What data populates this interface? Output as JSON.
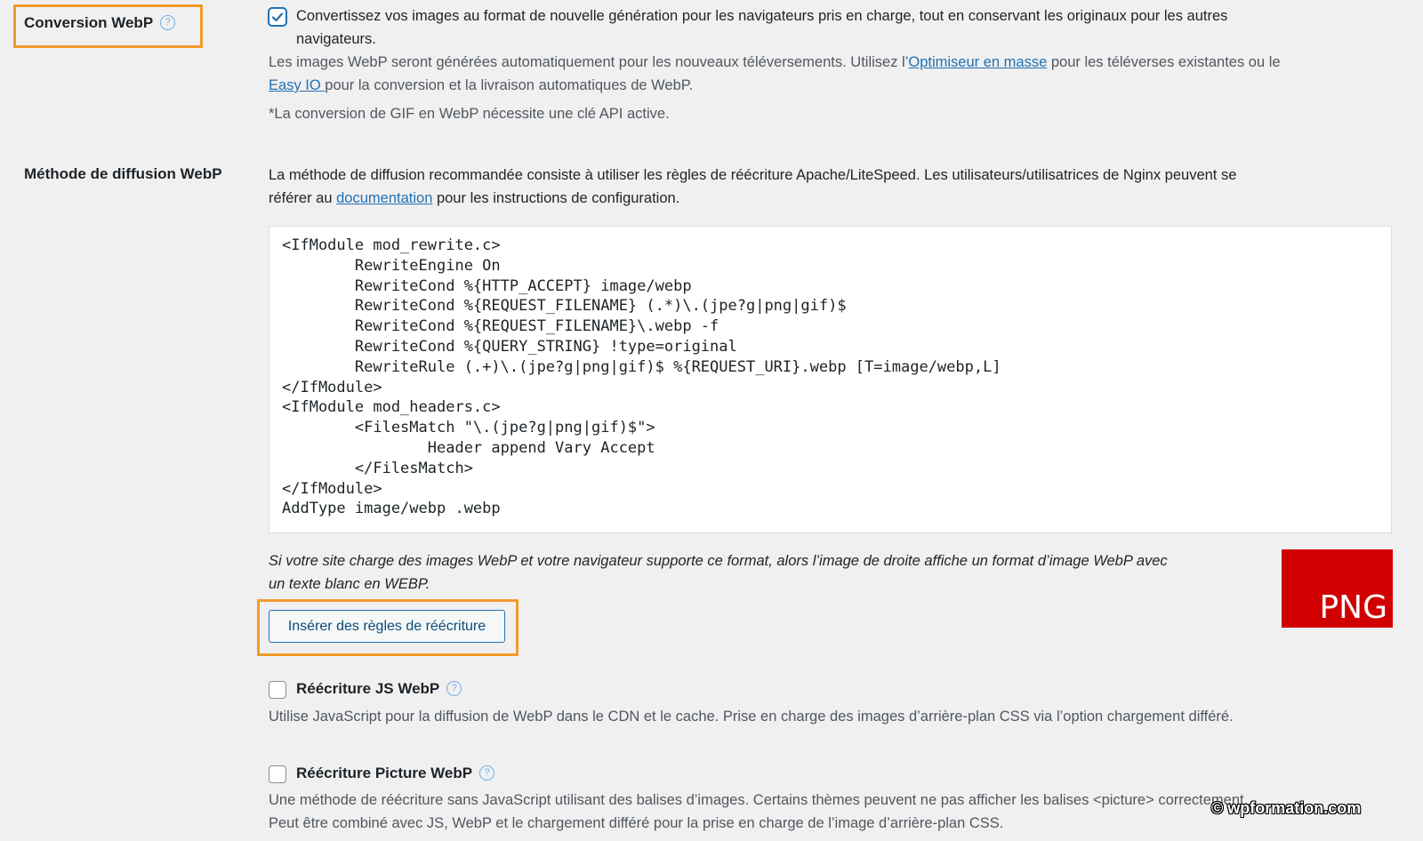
{
  "webp_conversion": {
    "label": "Conversion WebP",
    "help_symbol": "?",
    "checked": true,
    "checkbox_text_line1": "Convertissez vos images au format de nouvelle génération pour les navigateurs pris en charge, tout en conservant les originaux pour les autres",
    "checkbox_text_line2": "navigateurs.",
    "desc_line1_before": "Les images WebP seront générées automatiquement pour les nouveaux téléversements. Utilisez l’",
    "bulk_optimizer_link": "Optimiseur en masse",
    "desc_line1_after": " pour les téléverses existantes ou le",
    "easy_io_link": "Easy IO ",
    "desc_line2_after": "pour la conversion et la livraison automatiques de WebP.",
    "gif_note": "*La conversion de GIF en WebP nécessite une clé API active."
  },
  "webp_delivery": {
    "label": "Méthode de diffusion WebP",
    "intro_line1": "La méthode de diffusion recommandée consiste à utiliser les règles de réécriture Apache/LiteSpeed. Les utilisateurs/utilisatrices de Nginx peuvent se",
    "intro_line2_before": "référer au ",
    "documentation_link": "documentation",
    "intro_line2_after": " pour les instructions de configuration.",
    "code_lines": [
      "<IfModule mod_rewrite.c>",
      "        RewriteEngine On",
      "        RewriteCond %{HTTP_ACCEPT} image/webp",
      "        RewriteCond %{REQUEST_FILENAME} (.*)\\.(jpe?g|png|gif)$",
      "        RewriteCond %{REQUEST_FILENAME}\\.webp -f",
      "        RewriteCond %{QUERY_STRING} !type=original",
      "        RewriteRule (.+)\\.(jpe?g|png|gif)$ %{REQUEST_URI}.webp [T=image/webp,L]",
      "</IfModule>",
      "<IfModule mod_headers.c>",
      "        <FilesMatch \"\\.(jpe?g|png|gif)$\">",
      "                Header append Vary Accept",
      "        </FilesMatch>",
      "</IfModule>",
      "AddType image/webp .webp"
    ],
    "test_note_line1": "Si votre site charge des images WebP et votre navigateur supporte ce format, alors l’image de droite affiche un format d’image WebP avec",
    "test_note_line2": "un texte blanc en WEBP.",
    "insert_button": "Insérer des règles de réécriture",
    "test_image_text": "PNG",
    "test_image_color": "#d10000"
  },
  "js_rewrite": {
    "label": "Réécriture JS WebP",
    "help_symbol": "?",
    "checked": false,
    "description": "Utilise JavaScript pour la diffusion de WebP dans le CDN et le cache. Prise en charge des images d’arrière-plan CSS via l’option chargement différé."
  },
  "picture_rewrite": {
    "label": "Réécriture Picture WebP",
    "help_symbol": "?",
    "checked": false,
    "desc_line1": "Une méthode de réécriture sans JavaScript utilisant des balises d’images. Certains thèmes peuvent ne pas afficher les balises <picture> correctement.",
    "desc_line2": "Peut être combiné avec JS, WebP et le chargement différé pour la prise en charge de l’image d’arrière-plan CSS."
  },
  "watermark": "© wpformation.com",
  "colors": {
    "highlight": "#f39a2b",
    "link": "#2271b1",
    "background": "#f0f0f1"
  }
}
